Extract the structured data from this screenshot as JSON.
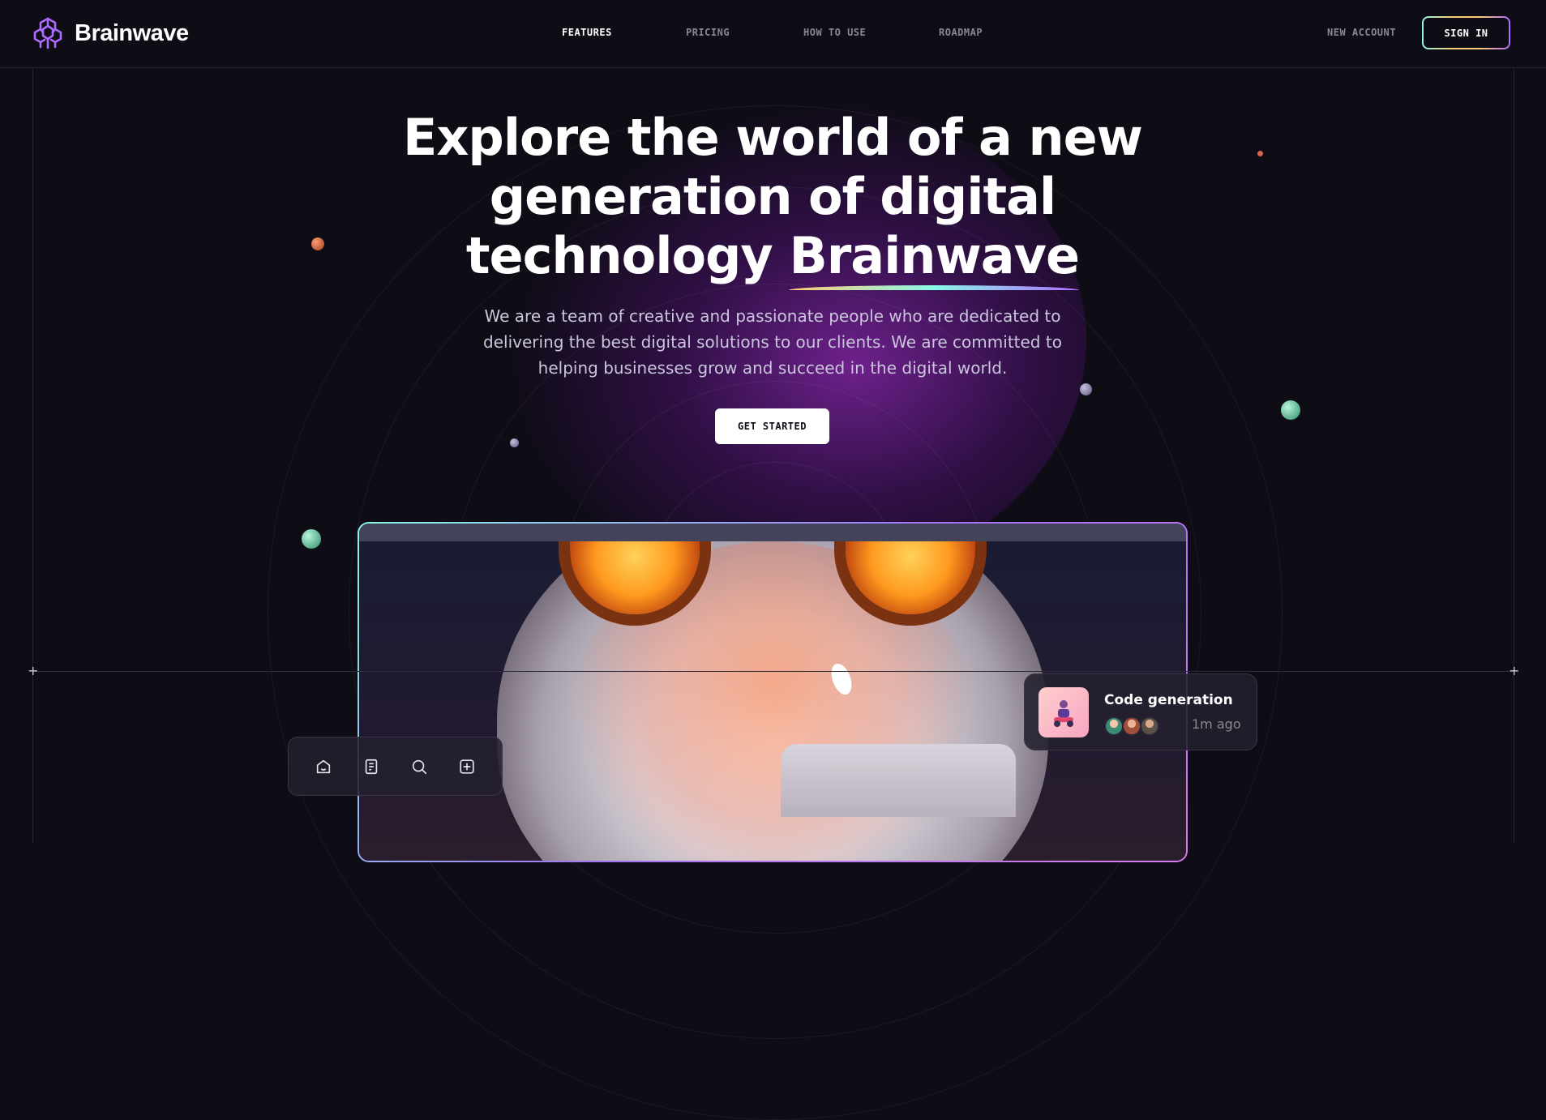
{
  "brand": {
    "name": "Brainwave",
    "logo_icon": "brain-icon"
  },
  "nav": {
    "items": [
      {
        "label": "FEATURES",
        "active": true
      },
      {
        "label": "PRICING",
        "active": false
      },
      {
        "label": "HOW TO USE",
        "active": false
      },
      {
        "label": "ROADMAP",
        "active": false
      }
    ],
    "new_account_label": "NEW ACCOUNT",
    "sign_in_label": "SIGN IN"
  },
  "hero": {
    "title_before": "Explore the world of a new generation of digital technology",
    "title_highlight": "Brainwave",
    "subtitle": "We are a team of creative and passionate people who are dedicated to delivering the best digital solutions to our clients. We are committed to helping businesses grow and succeed in the digital world.",
    "cta_label": "GET STARTED"
  },
  "toolbar": {
    "icons": [
      "home-icon",
      "document-icon",
      "search-icon",
      "plus-square-icon"
    ]
  },
  "notification": {
    "title": "Code generation",
    "time": "1m ago"
  },
  "colors": {
    "background": "#0e0c15",
    "accent_purple": "#ac6aff",
    "accent_teal": "#89f9e8",
    "accent_yellow": "#ffc876",
    "muted_text": "#8a8791"
  }
}
